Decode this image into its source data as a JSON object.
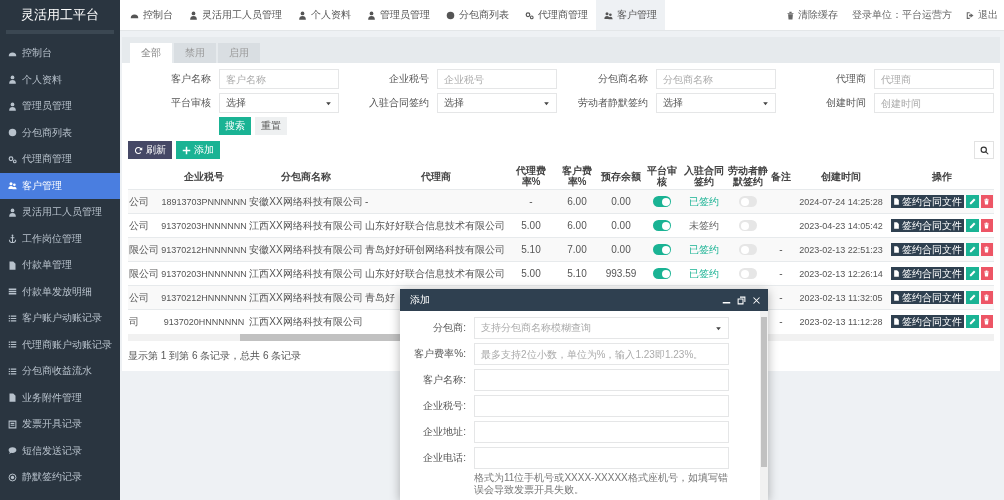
{
  "app_title": "灵活用工平台",
  "sidebar": {
    "items": [
      {
        "label": "控制台",
        "selected": false
      },
      {
        "label": "个人资料",
        "selected": false
      },
      {
        "label": "管理员管理",
        "selected": false
      },
      {
        "label": "分包商列表",
        "selected": false
      },
      {
        "label": "代理商管理",
        "selected": false
      },
      {
        "label": "客户管理",
        "selected": true
      },
      {
        "label": "灵活用工人员管理",
        "selected": false
      },
      {
        "label": "工作岗位管理",
        "selected": false
      },
      {
        "label": "付款单管理",
        "selected": false
      },
      {
        "label": "付款单发放明细",
        "selected": false
      },
      {
        "label": "客户账户动账记录",
        "selected": false
      },
      {
        "label": "代理商账户动账记录",
        "selected": false
      },
      {
        "label": "分包商收益流水",
        "selected": false
      },
      {
        "label": "业务附件管理",
        "selected": false
      },
      {
        "label": "发票开具记录",
        "selected": false
      },
      {
        "label": "短信发送记录",
        "selected": false
      },
      {
        "label": "静默签约记录",
        "selected": false
      }
    ]
  },
  "top_nav": {
    "tabs": [
      {
        "label": "控制台",
        "selected": false
      },
      {
        "label": "灵活用工人员管理",
        "selected": false
      },
      {
        "label": "个人资料",
        "selected": false
      },
      {
        "label": "管理员管理",
        "selected": false
      },
      {
        "label": "分包商列表",
        "selected": false
      },
      {
        "label": "代理商管理",
        "selected": false
      },
      {
        "label": "客户管理",
        "selected": true
      }
    ],
    "clear_cache": "清除缓存",
    "login_unit": "登录单位：平台运营方",
    "logout": "退出"
  },
  "status_tabs": [
    {
      "label": "全部",
      "selected": true
    },
    {
      "label": "禁用",
      "selected": false
    },
    {
      "label": "启用",
      "selected": false
    }
  ],
  "filters": [
    {
      "label": "客户名称",
      "kind": "input",
      "placeholder": "客户名称"
    },
    {
      "label": "企业税号",
      "kind": "input",
      "placeholder": "企业税号"
    },
    {
      "label": "分包商名称",
      "kind": "input",
      "placeholder": "分包商名称"
    },
    {
      "label": "代理商",
      "kind": "input",
      "placeholder": "代理商"
    },
    {
      "label": "平台审核",
      "kind": "select",
      "value": "选择"
    },
    {
      "label": "入驻合同签约",
      "kind": "select",
      "value": "选择"
    },
    {
      "label": "劳动者静默签约",
      "kind": "select",
      "value": "选择"
    },
    {
      "label": "创建时间",
      "kind": "input",
      "placeholder": "创建时间"
    }
  ],
  "search_button": "搜索",
  "reset_button": "重置",
  "refresh_button": "刷新",
  "add_button": "添加",
  "table": {
    "columns": [
      "企业税号",
      "分包商名称",
      "代理商",
      "代理费率%",
      "客户费率%",
      "预存余额",
      "平台审核",
      "入驻合同签约",
      "劳动者静默签约",
      "备注",
      "创建时间",
      "操作"
    ],
    "rows": [
      {
        "column_1": "公司",
        "tax_no": "18913703PNNNNNN",
        "subcontractor": "安徽XX网络科技有限公司",
        "agent": "-",
        "agent_rate": "-",
        "customer_rate": "6.00",
        "balance": "0.00",
        "platform_review": true,
        "contract": "已签约",
        "contract_signed": true,
        "silent_signed": false,
        "created": "2024-07-24 14:25:28",
        "contract_file_button": "签约合同文件"
      },
      {
        "column_1": "公司",
        "tax_no": "91370203HNNNNNN",
        "subcontractor": "江西XX网络科技有限公司",
        "agent": "山东好好联合信息技术有限公司",
        "agent_rate": "5.00",
        "customer_rate": "6.00",
        "balance": "0.00",
        "platform_review": true,
        "contract": "未签约",
        "contract_signed": false,
        "silent_signed": false,
        "created": "2023-04-23 14:05:42",
        "contract_file_button": "签约合同文件"
      },
      {
        "column_1": "限公司",
        "tax_no": "91370212HNNNNNN",
        "subcontractor": "安徽XX网络科技有限公司",
        "agent": "青岛好好研创网络科技有限公司",
        "agent_rate": "5.10",
        "customer_rate": "7.00",
        "balance": "0.00",
        "platform_review": true,
        "contract": "已签约",
        "contract_signed": true,
        "silent_signed": false,
        "remark": "-",
        "created": "2023-02-13 22:51:23",
        "contract_file_button": "签约合同文件"
      },
      {
        "column_1": "限公司",
        "tax_no": "91370203HNNNNNN",
        "subcontractor": "江西XX网络科技有限公司",
        "agent": "山东好好联合信息技术有限公司",
        "agent_rate": "5.00",
        "customer_rate": "5.10",
        "balance": "993.59",
        "platform_review": true,
        "contract": "已签约",
        "contract_signed": true,
        "silent_signed": false,
        "remark": "-",
        "created": "2023-02-13 12:26:14",
        "contract_file_button": "签约合同文件"
      },
      {
        "column_1": "公司",
        "tax_no": "91370212HNNNNNN",
        "subcontractor": "江西XX网络科技有限公司",
        "agent": "青岛好",
        "remark": "-",
        "created": "2023-02-13 11:32:05",
        "contract_file_button": "签约合同文件"
      },
      {
        "column_1": "司",
        "tax_no": "9137020HNNNNNN",
        "subcontractor": "江西XX网络科技有限公司",
        "remark": "-",
        "created": "2023-02-13 11:12:28",
        "contract_file_button": "签约合同文件"
      }
    ]
  },
  "footer": "显示第 1 到第 6 条记录，总共 6 条记录",
  "dialog": {
    "title": "添加",
    "fields": [
      {
        "label": "分包商:",
        "kind": "select",
        "placeholder": "支持分包商名称模糊查询"
      },
      {
        "label": "客户费率%:",
        "kind": "input",
        "placeholder": "最多支持2位小数，单位为%，输入1.23即1.23%。"
      },
      {
        "label": "客户名称:",
        "kind": "input"
      },
      {
        "label": "企业税号:",
        "kind": "input"
      },
      {
        "label": "企业地址:",
        "kind": "input"
      },
      {
        "label": "企业电话:",
        "kind": "input",
        "hint": "格式为11位手机号或XXXX-XXXXX格式座机号，如填写错误会导致发票开具失败。"
      }
    ]
  }
}
